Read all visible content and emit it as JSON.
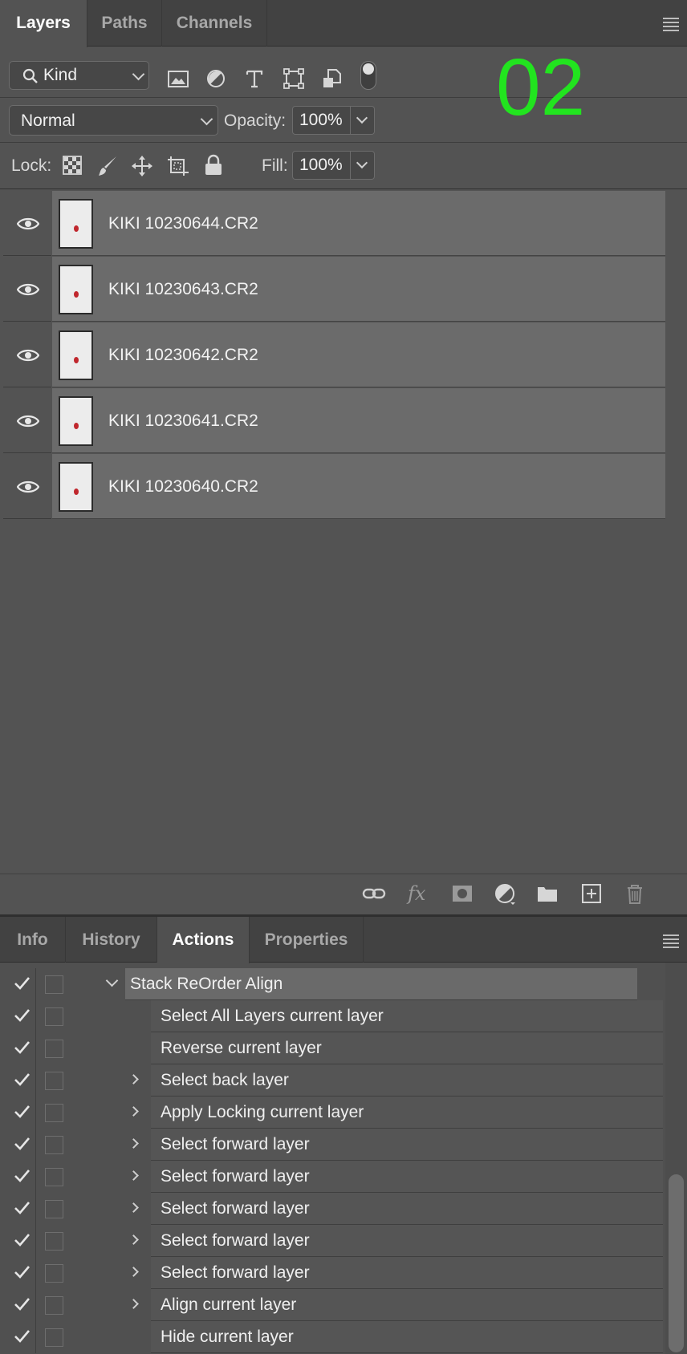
{
  "layers_panel": {
    "tabs": [
      "Layers",
      "Paths",
      "Channels"
    ],
    "active_tab": "Layers",
    "filter": {
      "label": "Kind",
      "toggle": "on"
    },
    "filter_icons": [
      "image-filter-icon",
      "adjustment-filter-icon",
      "type-filter-icon",
      "shape-filter-icon",
      "smart-object-filter-icon"
    ],
    "overlay_number": "02",
    "overlay_color": "#22e41f",
    "blend_mode": "Normal",
    "opacity_label": "Opacity:",
    "opacity": "100%",
    "lock_label": "Lock:",
    "lock_icons": [
      "lock-transparent-pixels-icon",
      "lock-image-pixels-icon",
      "lock-position-icon",
      "lock-artboard-icon",
      "lock-all-icon"
    ],
    "fill_label": "Fill:",
    "fill": "100%",
    "layers": [
      {
        "name": "KIKI 10230644.CR2",
        "visible": true
      },
      {
        "name": "KIKI 10230643.CR2",
        "visible": true
      },
      {
        "name": "KIKI 10230642.CR2",
        "visible": true
      },
      {
        "name": "KIKI 10230641.CR2",
        "visible": true
      },
      {
        "name": "KIKI 10230640.CR2",
        "visible": true
      }
    ],
    "footer_icons": [
      "link-layers-icon",
      "fx-icon",
      "add-mask-icon",
      "adjustment-layer-icon",
      "new-group-icon",
      "new-layer-icon",
      "delete-layer-icon"
    ]
  },
  "actions_panel": {
    "tabs": [
      "Info",
      "History",
      "Actions",
      "Properties"
    ],
    "active_tab": "Actions",
    "group": {
      "name": "Stack ReOrder Align",
      "expanded": true
    },
    "steps": [
      {
        "label": "Select All Layers current layer",
        "expandable": false
      },
      {
        "label": "Reverse current layer",
        "expandable": false
      },
      {
        "label": "Select back layer",
        "expandable": true
      },
      {
        "label": "Apply Locking current layer",
        "expandable": true
      },
      {
        "label": "Select forward layer",
        "expandable": true
      },
      {
        "label": "Select forward layer",
        "expandable": true
      },
      {
        "label": "Select forward layer",
        "expandable": true
      },
      {
        "label": "Select forward layer",
        "expandable": true
      },
      {
        "label": "Select forward layer",
        "expandable": true
      },
      {
        "label": "Align current layer",
        "expandable": true
      },
      {
        "label": "Hide current layer",
        "expandable": false
      }
    ]
  },
  "colors": {
    "panel_bg": "#535353",
    "layer_row_bg": "#6b6b6b",
    "tab_bar_bg": "#424242"
  }
}
